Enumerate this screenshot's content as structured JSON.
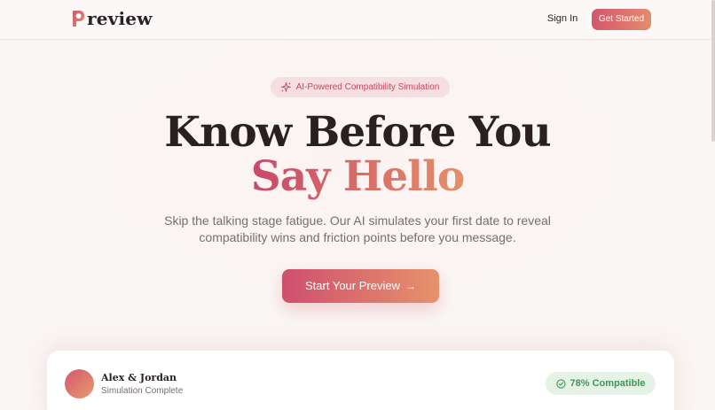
{
  "header": {
    "logo_text": "review",
    "signin_label": "Sign In",
    "get_started_label": "Get Started"
  },
  "hero": {
    "badge_icon": "sparkles-icon",
    "badge_text": "AI-Powered Compatibility Simulation",
    "headline_line1": "Know Before You",
    "headline_line2": "Say Hello",
    "subtitle": "Skip the talking stage fatigue. Our AI simulates your first date to reveal compatibility wins and friction points before you message.",
    "cta_label": "Start Your Preview",
    "cta_icon": "arrow-right-icon"
  },
  "card": {
    "names": "Alex & Jordan",
    "status": "Simulation Complete",
    "compat_icon": "check-circle-icon",
    "compat_text": "78% Compatible"
  },
  "colors": {
    "brand_start": "#d4566f",
    "brand_end": "#e48c6c",
    "success": "#3d9a52",
    "background": "#faf6f4"
  }
}
